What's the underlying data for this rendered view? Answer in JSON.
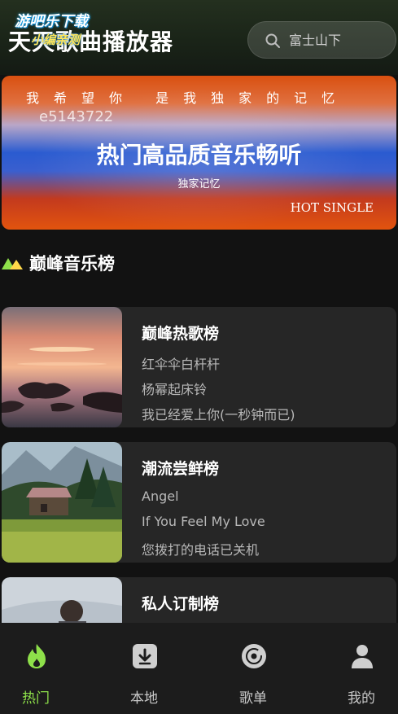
{
  "header": {
    "title": "天天歌曲播放器",
    "watermark_line1": "游吧乐下载",
    "watermark_line2": "小编亲测"
  },
  "search": {
    "placeholder": "富士山下",
    "icon": "search-icon"
  },
  "banner": {
    "lyric": "我希望你 是我独家的记忆",
    "code": "e5143722",
    "title": "热门高品质音乐畅听",
    "subtitle": "独家记忆",
    "tag": "HOT SINGLE"
  },
  "section": {
    "title": "巅峰音乐榜",
    "icon": "mountain-icon"
  },
  "charts": [
    {
      "title": "巅峰热歌榜",
      "songs": [
        "红伞伞白杆杆",
        "杨幂起床铃",
        "我已经爱上你(一秒钟而已)"
      ]
    },
    {
      "title": "潮流尝鲜榜",
      "songs": [
        "Angel",
        "If You Feel My Love",
        "您拨打的电话已关机"
      ]
    },
    {
      "title": "私人订制榜",
      "songs": []
    }
  ],
  "nav": [
    {
      "label": "热门",
      "icon": "flame-icon",
      "active": true
    },
    {
      "label": "本地",
      "icon": "download-icon",
      "active": false
    },
    {
      "label": "歌单",
      "icon": "disc-icon",
      "active": false
    },
    {
      "label": "我的",
      "icon": "user-icon",
      "active": false
    }
  ],
  "colors": {
    "accent": "#8ee04a",
    "background": "#121212",
    "card": "#262626"
  }
}
